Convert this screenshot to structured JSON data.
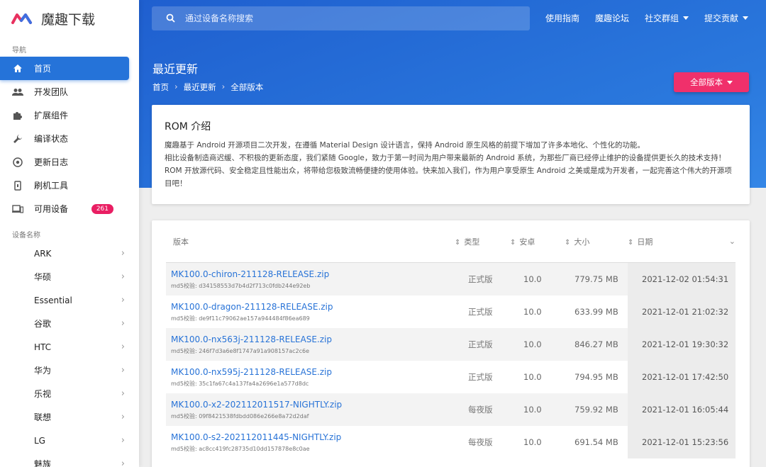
{
  "brand": {
    "title": "魔趣下载"
  },
  "search": {
    "placeholder": "通过设备名称搜索"
  },
  "topnav": {
    "guide": "使用指南",
    "forum": "魔趣论坛",
    "social": "社交群组",
    "contribute": "提交贡献"
  },
  "sidebar": {
    "nav_label": "导航",
    "items": [
      {
        "label": "首页",
        "icon": "home-icon"
      },
      {
        "label": "开发团队",
        "icon": "people-icon"
      },
      {
        "label": "扩展组件",
        "icon": "puzzle-icon"
      },
      {
        "label": "编译状态",
        "icon": "wrench-icon"
      },
      {
        "label": "更新日志",
        "icon": "changelog-icon"
      },
      {
        "label": "刷机工具",
        "icon": "phone-tool-icon"
      },
      {
        "label": "可用设备",
        "icon": "devices-icon",
        "badge": "261"
      }
    ],
    "devices_label": "设备名称",
    "devices": [
      "ARK",
      "华硕",
      "Essential",
      "谷歌",
      "HTC",
      "华为",
      "乐视",
      "联想",
      "LG",
      "魅族"
    ]
  },
  "page": {
    "title": "最近更新",
    "crumbs": [
      "首页",
      "最近更新",
      "全部版本"
    ],
    "all_versions": "全部版本"
  },
  "intro": {
    "title": "ROM 介绍",
    "p1": "魔趣基于 Android 开源项目二次开发，在遵循 Material Design 设计语言，保持 Android 原生风格的前提下增加了许多本地化、个性化的功能。",
    "p2": "相比设备制造商迟缓、不积极的更新态度，我们紧随 Google，致力于第一时间为用户带来最新的 Android 系统，为那些厂商已经停止维护的设备提供更长久的技术支持！",
    "p3": "ROM 开放源代码、安全稳定且性能出众，将带给您极致流畅便捷的使用体验。快来加入我们，作为用户享受原生 Android 之美或是成为开发者，一起完善这个伟大的开源项目吧！"
  },
  "table": {
    "headers": {
      "version": "版本",
      "type": "类型",
      "android": "安卓",
      "size": "大小",
      "date": "日期"
    },
    "rows": [
      {
        "name": "MK100.0-chiron-211128-RELEASE.zip",
        "md5": "md5校验: d34158553d7b4d2f713c0fdb244e92eb",
        "type": "正式版",
        "android": "10.0",
        "size": "779.75 MB",
        "date": "2021-12-02 01:54:31"
      },
      {
        "name": "MK100.0-dragon-211128-RELEASE.zip",
        "md5": "md5校验: de9f11c79062ae157a944484f86ea689",
        "type": "正式版",
        "android": "10.0",
        "size": "633.99 MB",
        "date": "2021-12-01 21:02:32"
      },
      {
        "name": "MK100.0-nx563j-211128-RELEASE.zip",
        "md5": "md5校验: 246f7d3a6e8f1747a91a908157ac2c6e",
        "type": "正式版",
        "android": "10.0",
        "size": "846.27 MB",
        "date": "2021-12-01 19:30:32"
      },
      {
        "name": "MK100.0-nx595j-211128-RELEASE.zip",
        "md5": "md5校验: 35c1fa67c4a137fa4a2696e1a577d8dc",
        "type": "正式版",
        "android": "10.0",
        "size": "794.95 MB",
        "date": "2021-12-01 17:42:50"
      },
      {
        "name": "MK100.0-x2-202112011517-NIGHTLY.zip",
        "md5": "md5校验: 09f8421538fdbdd086e266e8a72d2daf",
        "type": "每夜版",
        "android": "10.0",
        "size": "759.92 MB",
        "date": "2021-12-01 16:05:44"
      },
      {
        "name": "MK100.0-s2-202112011445-NIGHTLY.zip",
        "md5": "md5校验: ac8cc419fc28735d10dd157878e8c0ae",
        "type": "每夜版",
        "android": "10.0",
        "size": "691.54 MB",
        "date": "2021-12-01 15:23:56"
      }
    ]
  }
}
